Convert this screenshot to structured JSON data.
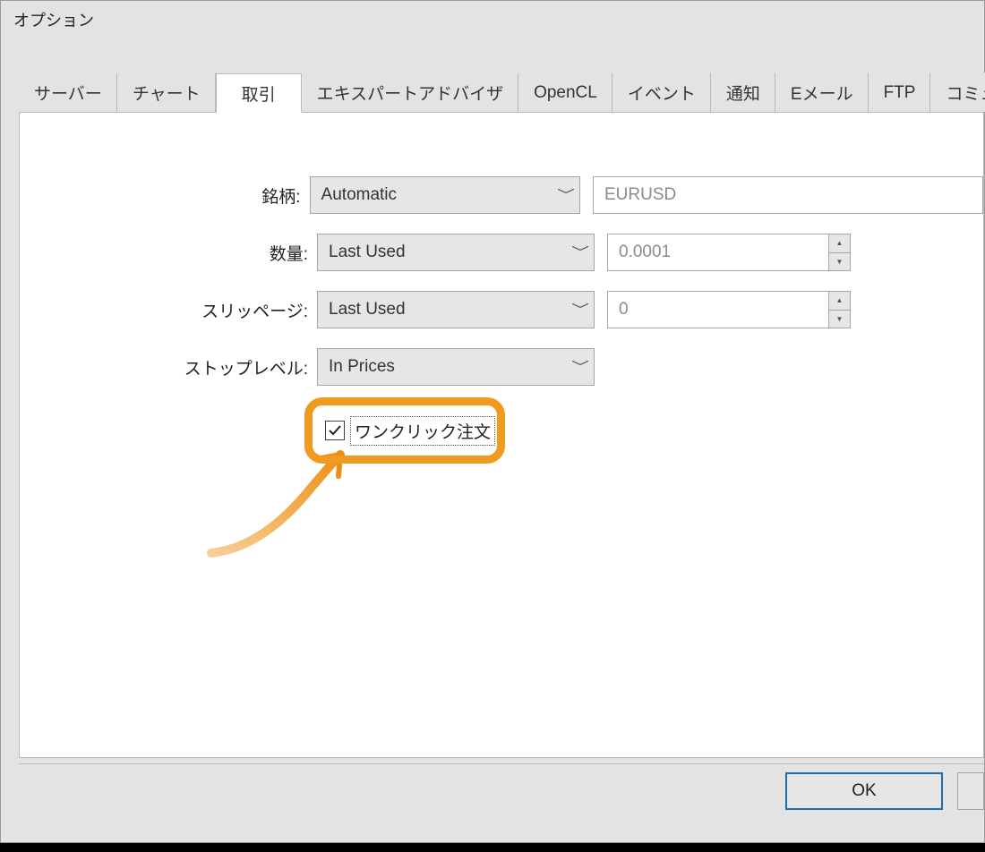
{
  "window": {
    "title": "オプション"
  },
  "tabs": [
    {
      "label": "サーバー"
    },
    {
      "label": "チャート"
    },
    {
      "label": "取引",
      "active": true
    },
    {
      "label": "エキスパートアドバイザ"
    },
    {
      "label": "OpenCL"
    },
    {
      "label": "イベント"
    },
    {
      "label": "通知"
    },
    {
      "label": "Eメール"
    },
    {
      "label": "FTP"
    },
    {
      "label": "コミュニ"
    }
  ],
  "form": {
    "symbol": {
      "label": "銘柄:",
      "mode": "Automatic",
      "value": "EURUSD"
    },
    "volume": {
      "label": "数量:",
      "mode": "Last Used",
      "value": "0.0001"
    },
    "slippage": {
      "label": "スリッページ:",
      "mode": "Last Used",
      "value": "0"
    },
    "stop": {
      "label": "ストップレベル:",
      "mode": "In Prices"
    },
    "oneclick": {
      "label": "ワンクリック注文",
      "checked": true
    }
  },
  "footer": {
    "ok": "OK"
  },
  "colors": {
    "highlight": "#ef9b20"
  }
}
